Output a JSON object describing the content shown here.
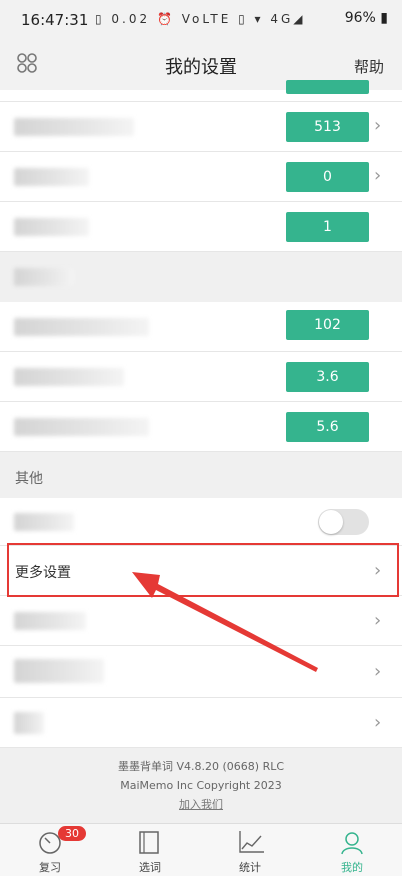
{
  "status_bar": {
    "time": "16:47:31",
    "icons": "▯ 0.02 ⏰ VoLTE ▯ ▾ 4G◢",
    "battery": "96%"
  },
  "header": {
    "title": "我的设置",
    "help": "帮助"
  },
  "settings_rows": [
    {
      "value": "513"
    },
    {
      "value": "0"
    },
    {
      "value": "1"
    },
    {
      "value": "102"
    },
    {
      "value": "3.6"
    },
    {
      "value": "5.6"
    }
  ],
  "sections": {
    "other": "其他"
  },
  "more_settings": {
    "label": "更多设置"
  },
  "footer": {
    "version": "墨墨背单词 V4.8.20 (0668) RLC",
    "copyright": "MaiMemo Inc Copyright 2023",
    "join": "加入我们"
  },
  "tabs": [
    {
      "label": "复习",
      "badge": "30"
    },
    {
      "label": "选词"
    },
    {
      "label": "统计"
    },
    {
      "label": "我的"
    }
  ],
  "colors": {
    "accent": "#35b48e",
    "highlight": "#e53935"
  }
}
